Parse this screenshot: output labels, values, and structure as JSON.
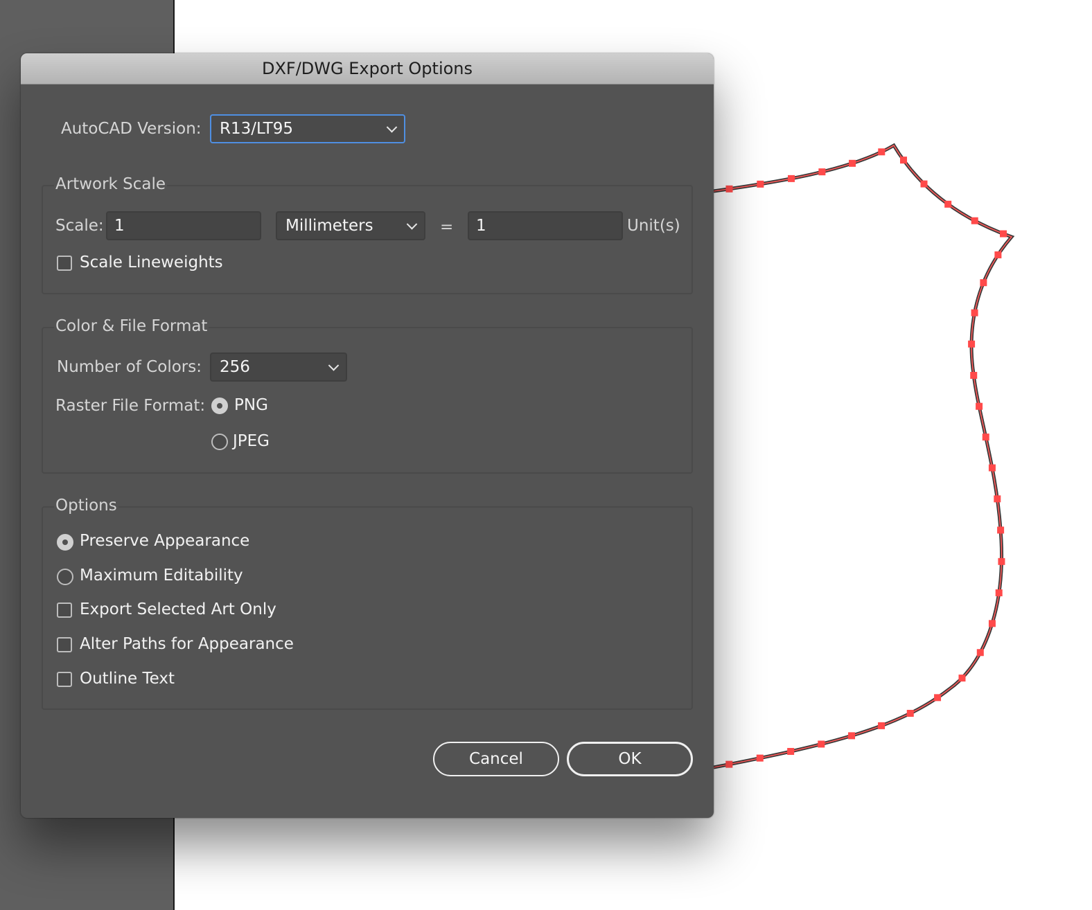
{
  "dialog": {
    "title": "DXF/DWG Export Options",
    "autocad_version": {
      "label": "AutoCAD Version:",
      "value": "R13/LT95"
    },
    "artwork_scale": {
      "title": "Artwork Scale",
      "scale_label": "Scale:",
      "scale_value": "1",
      "unit_select": "Millimeters",
      "equals": "=",
      "units_value": "1",
      "units_label": "Unit(s)",
      "scale_lineweights": {
        "label": "Scale Lineweights",
        "checked": false
      }
    },
    "color_file_format": {
      "title": "Color & File Format",
      "num_colors_label": "Number of Colors:",
      "num_colors_value": "256",
      "raster_label": "Raster File Format:",
      "raster_options": [
        {
          "label": "PNG",
          "selected": true
        },
        {
          "label": "JPEG",
          "selected": false
        }
      ]
    },
    "options": {
      "title": "Options",
      "radios": [
        {
          "label": "Preserve Appearance",
          "selected": true
        },
        {
          "label": "Maximum Editability",
          "selected": false
        }
      ],
      "checkboxes": [
        {
          "label": "Export Selected Art Only",
          "checked": false
        },
        {
          "label": "Alter Paths for Appearance",
          "checked": false
        },
        {
          "label": "Outline Text",
          "checked": false
        }
      ]
    },
    "buttons": {
      "cancel": "Cancel",
      "ok": "OK"
    }
  },
  "artwork": {
    "path_color": "#3a3a3a",
    "anchor_color": "#ff4a4a"
  }
}
